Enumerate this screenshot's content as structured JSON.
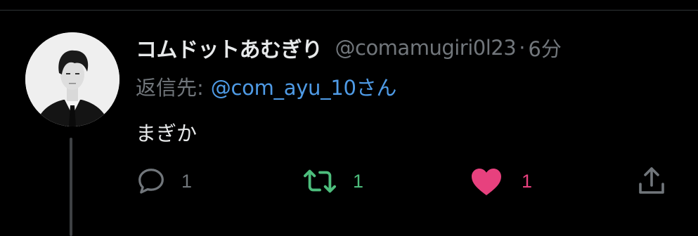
{
  "tweet": {
    "author": {
      "display_name": "コムドットあむぎり",
      "handle": "@comamugiri0l23",
      "separator": "·",
      "time": "6分"
    },
    "reply": {
      "label": "返信先:",
      "target": "@com_ayu_10さん"
    },
    "text": "まぎか",
    "actions": {
      "reply_count": "1",
      "retweet_count": "1",
      "like_count": "1"
    }
  },
  "colors": {
    "background": "#000000",
    "primary_text": "#e7e9ea",
    "secondary_text": "#71767b",
    "link": "#4f9be6",
    "retweet_active": "#4dbd7c",
    "like_active": "#e7417e"
  },
  "icons": {
    "reply": "reply-icon",
    "retweet": "retweet-icon",
    "like": "heart-icon",
    "share": "share-icon"
  }
}
